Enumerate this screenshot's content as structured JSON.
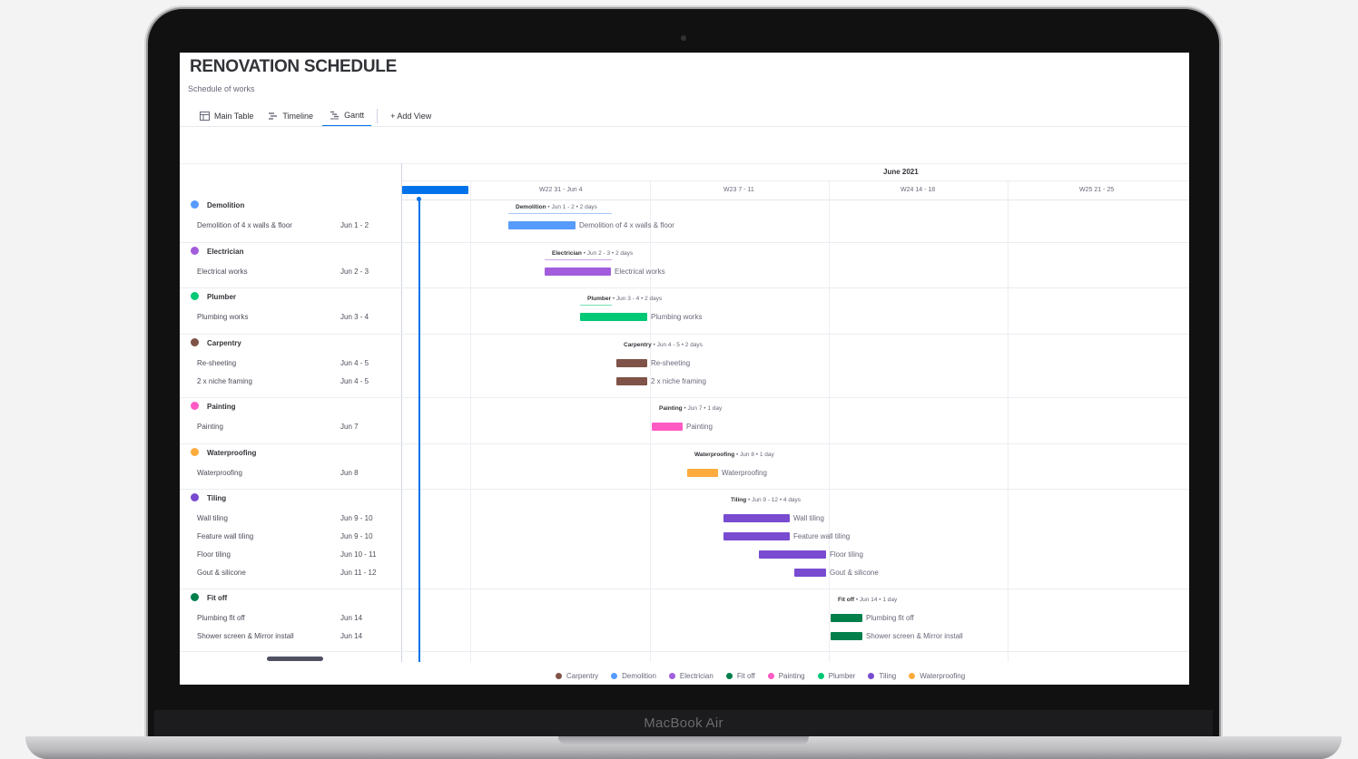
{
  "device": {
    "label": "MacBook Air"
  },
  "board": {
    "title": "RENOVATION SCHEDULE",
    "subtitle": "Schedule of works"
  },
  "tabs": [
    {
      "label": "Main Table",
      "icon": "table-icon"
    },
    {
      "label": "Timeline",
      "icon": "timeline-icon"
    },
    {
      "label": "Gantt",
      "icon": "gantt-icon",
      "active": true
    },
    {
      "label": "+ Add View"
    }
  ],
  "gantt": {
    "month": "June 2021",
    "weeks": [
      "W22  31 - Jun 4",
      "W23  7 - 11",
      "W24  14 - 18",
      "W25  21 - 25"
    ],
    "groups": [
      {
        "name": "Demolition",
        "color": "#579bfc",
        "summary": "Jun 1 - 2 • 2 days",
        "tasks": [
          {
            "name": "Demolition of 4 x walls & floor",
            "date": "Jun 1 - 2"
          }
        ]
      },
      {
        "name": "Electrician",
        "color": "#a25ddc",
        "summary": "Jun 2 - 3 • 2 days",
        "tasks": [
          {
            "name": "Electrical works",
            "date": "Jun 2 - 3"
          }
        ]
      },
      {
        "name": "Plumber",
        "color": "#00c875",
        "summary": "Jun 3 - 4 • 2 days",
        "tasks": [
          {
            "name": "Plumbing works",
            "date": "Jun 3 - 4"
          }
        ]
      },
      {
        "name": "Carpentry",
        "color": "#7f5347",
        "summary": "Jun 4 - 5 • 2 days",
        "tasks": [
          {
            "name": "Re-sheeting",
            "date": "Jun 4 - 5"
          },
          {
            "name": "2 x niche framing",
            "date": "Jun 4 - 5"
          }
        ]
      },
      {
        "name": "Painting",
        "color": "#ff5ac4",
        "summary": "Jun 7 • 1 day",
        "tasks": [
          {
            "name": "Painting",
            "date": "Jun 7"
          }
        ]
      },
      {
        "name": "Waterproofing",
        "color": "#fdab3d",
        "summary": "Jun 8 • 1 day",
        "tasks": [
          {
            "name": "Waterproofing",
            "date": "Jun 8"
          }
        ]
      },
      {
        "name": "Tiling",
        "color": "#784bd1",
        "summary": "Jun 9 - 12 • 4 days",
        "tasks": [
          {
            "name": "Wall tiling",
            "date": "Jun 9 - 10"
          },
          {
            "name": "Feature wall tiling",
            "date": "Jun 9 - 10"
          },
          {
            "name": "Floor tiling",
            "date": "Jun 10 - 11"
          },
          {
            "name": "Gout & silicone",
            "date": "Jun 11 - 12"
          }
        ]
      },
      {
        "name": "Fit off",
        "color": "#037f4c",
        "summary": "Jun 14 • 1 day",
        "tasks": [
          {
            "name": "Plumbing fit off",
            "date": "Jun 14"
          },
          {
            "name": "Shower screen & Mirror install",
            "date": "Jun 14"
          }
        ]
      }
    ]
  },
  "legend": [
    {
      "label": "Carpentry",
      "color": "#7f5347"
    },
    {
      "label": "Demolition",
      "color": "#579bfc"
    },
    {
      "label": "Electrician",
      "color": "#a25ddc"
    },
    {
      "label": "Fit off",
      "color": "#037f4c"
    },
    {
      "label": "Painting",
      "color": "#ff5ac4"
    },
    {
      "label": "Plumber",
      "color": "#00c875"
    },
    {
      "label": "Tiling",
      "color": "#784bd1"
    },
    {
      "label": "Waterproofing",
      "color": "#fdab3d"
    }
  ]
}
